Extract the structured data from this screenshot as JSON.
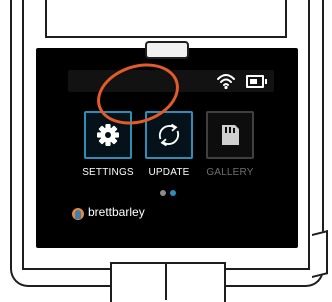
{
  "screen": {
    "apps": [
      {
        "label": "SETTINGS",
        "icon": "gear-icon",
        "state": "available"
      },
      {
        "label": "UPDATE",
        "icon": "refresh-icon",
        "state": "highlighted"
      },
      {
        "label": "GALLERY",
        "icon": "sd-card-icon",
        "state": "disabled"
      }
    ],
    "status_bar": {
      "wifi": "wifi-icon",
      "battery": "battery-icon"
    },
    "pager": {
      "pages": 2,
      "current": 2
    },
    "user": {
      "name": "brettbarley",
      "avatar": "avatar"
    }
  },
  "colors": {
    "accent": "#2d8fb8",
    "highlight": "#e45a28",
    "screen_bg": "#000000",
    "text": "#ffffff",
    "disabled_text": "#6e6e6e"
  }
}
